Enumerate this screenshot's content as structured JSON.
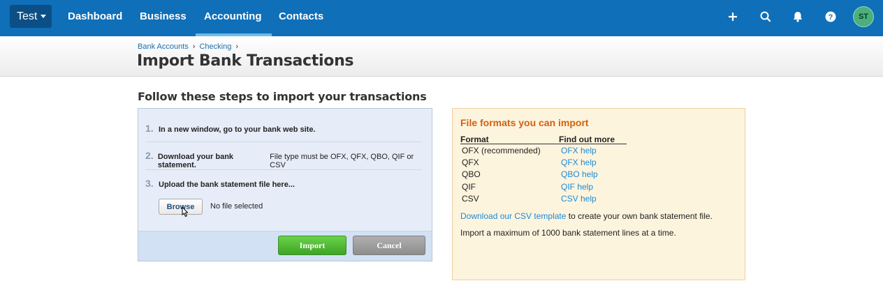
{
  "nav": {
    "org": "Test",
    "links": [
      "Dashboard",
      "Business",
      "Accounting",
      "Contacts"
    ],
    "active": "Accounting",
    "icons": [
      "plus-icon",
      "search-icon",
      "bell-icon",
      "help-icon"
    ],
    "avatar_initials": "ST"
  },
  "breadcrumb": {
    "items": [
      "Bank Accounts",
      "Checking"
    ],
    "separator": "›"
  },
  "page_title": "Import Bank Transactions",
  "steps_section": {
    "title": "Follow these steps to import your transactions",
    "steps": [
      {
        "num": "1.",
        "bold": "In a new window, go to your bank web site.",
        "text": ""
      },
      {
        "num": "2.",
        "bold": "Download your bank statement.",
        "text": "File type must be OFX, QFX, QBO, QIF or CSV"
      },
      {
        "num": "3.",
        "bold": "Upload the bank statement file here...",
        "text": ""
      }
    ],
    "browse_label": "Browse",
    "file_status": "No file selected",
    "import_label": "Import",
    "cancel_label": "Cancel"
  },
  "formats": {
    "title": "File formats you can import",
    "col_format": "Format",
    "col_more": "Find out more",
    "rows": [
      {
        "format": "OFX (recommended)",
        "help": "OFX help"
      },
      {
        "format": "QFX",
        "help": "QFX help"
      },
      {
        "format": "QBO",
        "help": "QBO help"
      },
      {
        "format": "QIF",
        "help": "QIF help"
      },
      {
        "format": "CSV",
        "help": "CSV help"
      }
    ],
    "csv_link": "Download our CSV template",
    "csv_text": " to create your own bank statement file.",
    "max_text": "Import a maximum of 1000 bank statement lines at a time."
  },
  "colors": {
    "nav_bg": "#0f6fb8",
    "accent_orange": "#d45f0e",
    "link_blue": "#1b8bd6",
    "import_green": "#4cb72f"
  }
}
